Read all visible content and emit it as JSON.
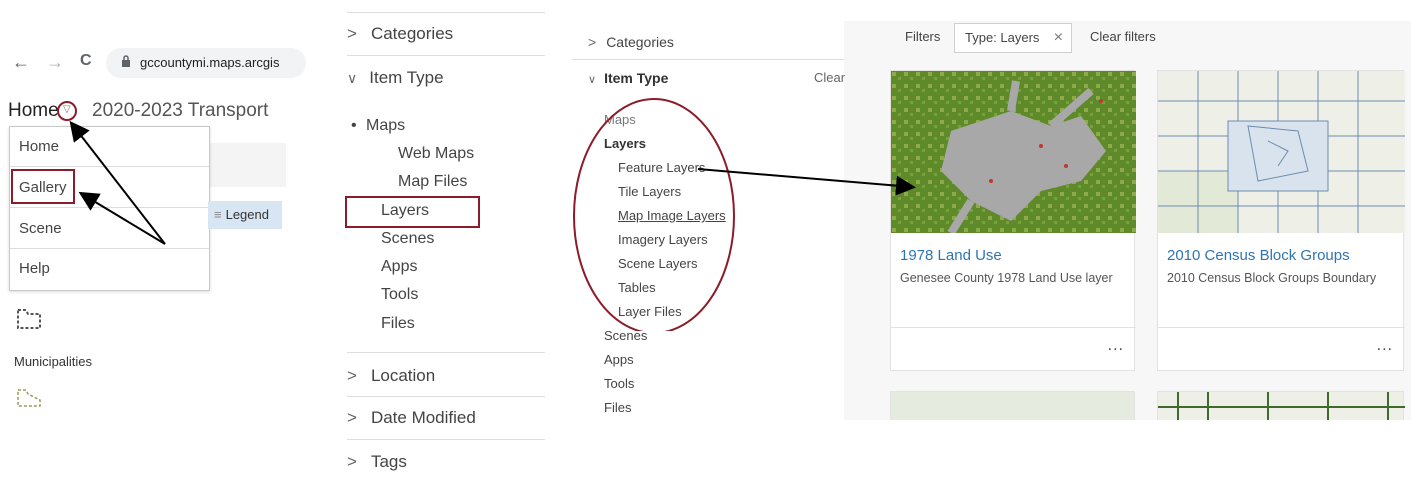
{
  "panel1": {
    "nav": {
      "back": "←",
      "forward": "→",
      "reload": "C"
    },
    "url": "gccountymi.maps.arcgis",
    "home_title": "Home",
    "app_title": "2020-2023 Transport",
    "menu": [
      "Home",
      "Gallery",
      "Scene",
      "Help"
    ],
    "legend_tab": "Legend",
    "legend_icon": "≡",
    "municipalities_label": "Municipalities"
  },
  "panel2": {
    "categories": "Categories",
    "item_type": "Item Type",
    "items": [
      "Maps",
      "Web Maps",
      "Map Files",
      "Layers",
      "Scenes",
      "Apps",
      "Tools",
      "Files"
    ],
    "location": "Location",
    "date_modified": "Date Modified",
    "tags": "Tags",
    "chevron_right": ">",
    "chevron_down": "∨"
  },
  "panel3": {
    "filters_label": "Filters",
    "chip_label": "Type: Layers",
    "chip_close": "×",
    "clear_filters": "Clear filters",
    "categories": "Categories",
    "item_type": "Item Type",
    "clear": "Clear",
    "sidebar_items": [
      "Maps",
      "Layers",
      "Feature Layers",
      "Tile Layers",
      "Map Image Layers",
      "Imagery Layers",
      "Scene Layers",
      "Tables",
      "Layer Files",
      "Scenes",
      "Apps",
      "Tools",
      "Files"
    ],
    "cards": [
      {
        "title": "1978 Land Use",
        "desc": "Genesee County 1978 Land Use layer",
        "more": "..."
      },
      {
        "title": "2010 Census Block Groups",
        "desc": "2010 Census Block Groups Boundary",
        "more": "..."
      }
    ]
  },
  "colors": {
    "accent": "#8c1c2a",
    "link": "#2e74b5",
    "legend_bg": "#d8e6f3"
  }
}
